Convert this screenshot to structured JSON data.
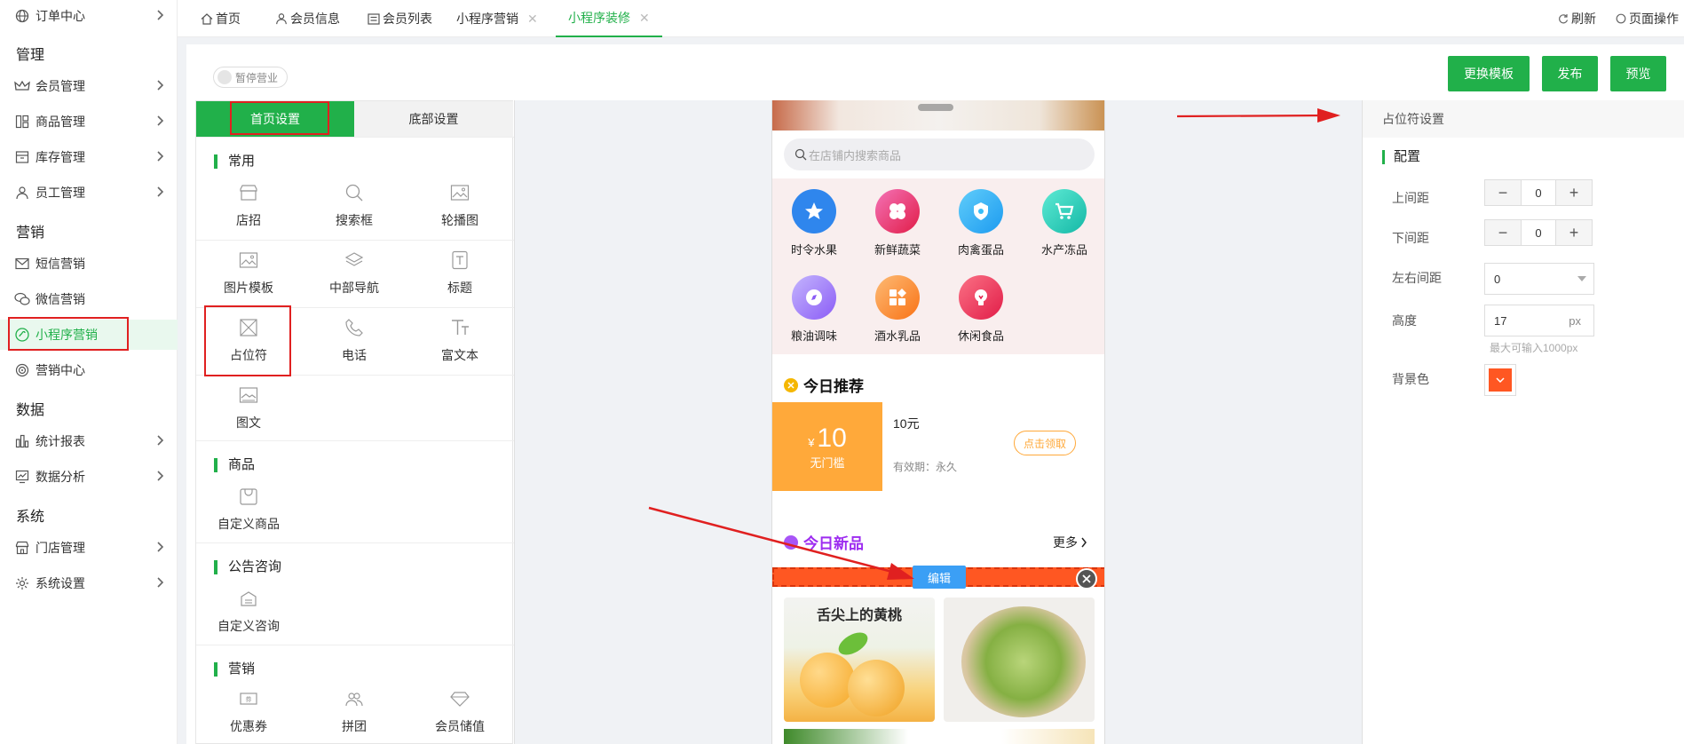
{
  "sidebar": {
    "top_item": {
      "label": "订单中心",
      "icon": "globe-icon"
    },
    "groups": [
      {
        "title": "管理",
        "items": [
          {
            "label": "会员管理",
            "icon": "crown-icon"
          },
          {
            "label": "商品管理",
            "icon": "grid-icon"
          },
          {
            "label": "库存管理",
            "icon": "box-icon"
          },
          {
            "label": "员工管理",
            "icon": "user-icon"
          }
        ]
      },
      {
        "title": "营销",
        "items": [
          {
            "label": "短信营销",
            "icon": "mail-icon"
          },
          {
            "label": "微信营销",
            "icon": "wechat-icon"
          },
          {
            "label": "小程序营销",
            "icon": "miniprogram-icon",
            "active": true
          },
          {
            "label": "营销中心",
            "icon": "target-icon"
          }
        ]
      },
      {
        "title": "数据",
        "items": [
          {
            "label": "统计报表",
            "icon": "bar-chart-icon"
          },
          {
            "label": "数据分析",
            "icon": "analysis-icon"
          }
        ]
      },
      {
        "title": "系统",
        "items": [
          {
            "label": "门店管理",
            "icon": "store-icon"
          },
          {
            "label": "系统设置",
            "icon": "gear-icon"
          }
        ]
      }
    ]
  },
  "tabs": [
    {
      "label": "首页",
      "icon": "home-icon"
    },
    {
      "label": "会员信息",
      "icon": "user-icon"
    },
    {
      "label": "会员列表",
      "icon": "list-icon"
    },
    {
      "label": "小程序营销",
      "closable": true
    },
    {
      "label": "小程序装修",
      "closable": true,
      "active": true
    }
  ],
  "tab_actions": {
    "refresh": "刷新",
    "page_ops": "页面操作"
  },
  "toolbar": {
    "pause_toggle": "暂停营业",
    "change_template": "更换模板",
    "publish": "发布",
    "preview": "预览"
  },
  "widget_panel": {
    "tabs": [
      "首页设置",
      "底部设置"
    ],
    "sections": [
      {
        "title": "常用",
        "widgets": [
          {
            "label": "店招",
            "icon": "shop-sign-icon"
          },
          {
            "label": "搜索框",
            "icon": "search-icon"
          },
          {
            "label": "轮播图",
            "icon": "carousel-icon"
          },
          {
            "label": "图片模板",
            "icon": "image-icon"
          },
          {
            "label": "中部导航",
            "icon": "layers-icon"
          },
          {
            "label": "标题",
            "icon": "title-icon"
          },
          {
            "label": "占位符",
            "icon": "placeholder-icon"
          },
          {
            "label": "电话",
            "icon": "phone-icon"
          },
          {
            "label": "富文本",
            "icon": "rich-text-icon"
          },
          {
            "label": "图文",
            "icon": "image-text-icon"
          }
        ]
      },
      {
        "title": "商品",
        "widgets": [
          {
            "label": "自定义商品",
            "icon": "bag-icon"
          }
        ]
      },
      {
        "title": "公告咨询",
        "widgets": [
          {
            "label": "自定义咨询",
            "icon": "notice-icon"
          }
        ]
      },
      {
        "title": "营销",
        "widgets": [
          {
            "label": "优惠券",
            "icon": "coupon-icon"
          },
          {
            "label": "拼团",
            "icon": "group-icon"
          },
          {
            "label": "会员储值",
            "icon": "diamond-icon"
          }
        ]
      }
    ]
  },
  "phone": {
    "search_placeholder": "在店铺内搜索商品",
    "categories": [
      {
        "label": "时令水果",
        "color": "#3b82f6",
        "icon": "star-icon"
      },
      {
        "label": "新鲜蔬菜",
        "color": "#ec4f8c",
        "icon": "flower-icon"
      },
      {
        "label": "肉禽蛋品",
        "color": "#38bdf8",
        "icon": "badge-icon"
      },
      {
        "label": "水产冻品",
        "color": "#2dd4bf",
        "icon": "cart-icon"
      },
      {
        "label": "粮油调味",
        "color": "#a78bfa",
        "icon": "compass-icon"
      },
      {
        "label": "酒水乳品",
        "color": "#fb923c",
        "icon": "apps-icon"
      },
      {
        "label": "休闲食品",
        "color": "#f43f5e",
        "icon": "bulb-icon"
      }
    ],
    "today_rec": "今日推荐",
    "coupon": {
      "currency": "¥",
      "amount": "10",
      "condition": "无门槛",
      "title": "10元",
      "validity": "有效期：永久",
      "claim": "点击领取"
    },
    "new_title": "今日新品",
    "more": "更多",
    "edit_label": "编辑",
    "product_title": "舌尖上的黄桃"
  },
  "props": {
    "header": "占位符设置",
    "section": "配置",
    "top_margin_label": "上间距",
    "top_margin_value": "0",
    "bottom_margin_label": "下间距",
    "bottom_margin_value": "0",
    "lr_margin_label": "左右间距",
    "lr_margin_value": "0",
    "height_label": "高度",
    "height_value": "17",
    "height_unit": "px",
    "height_hint": "最大可输入1000px",
    "bg_label": "背景色",
    "bg_color": "#ff5722"
  },
  "colors": {
    "accent": "#21b04a",
    "highlight": "#e02020",
    "coupon": "#ffa93a"
  }
}
